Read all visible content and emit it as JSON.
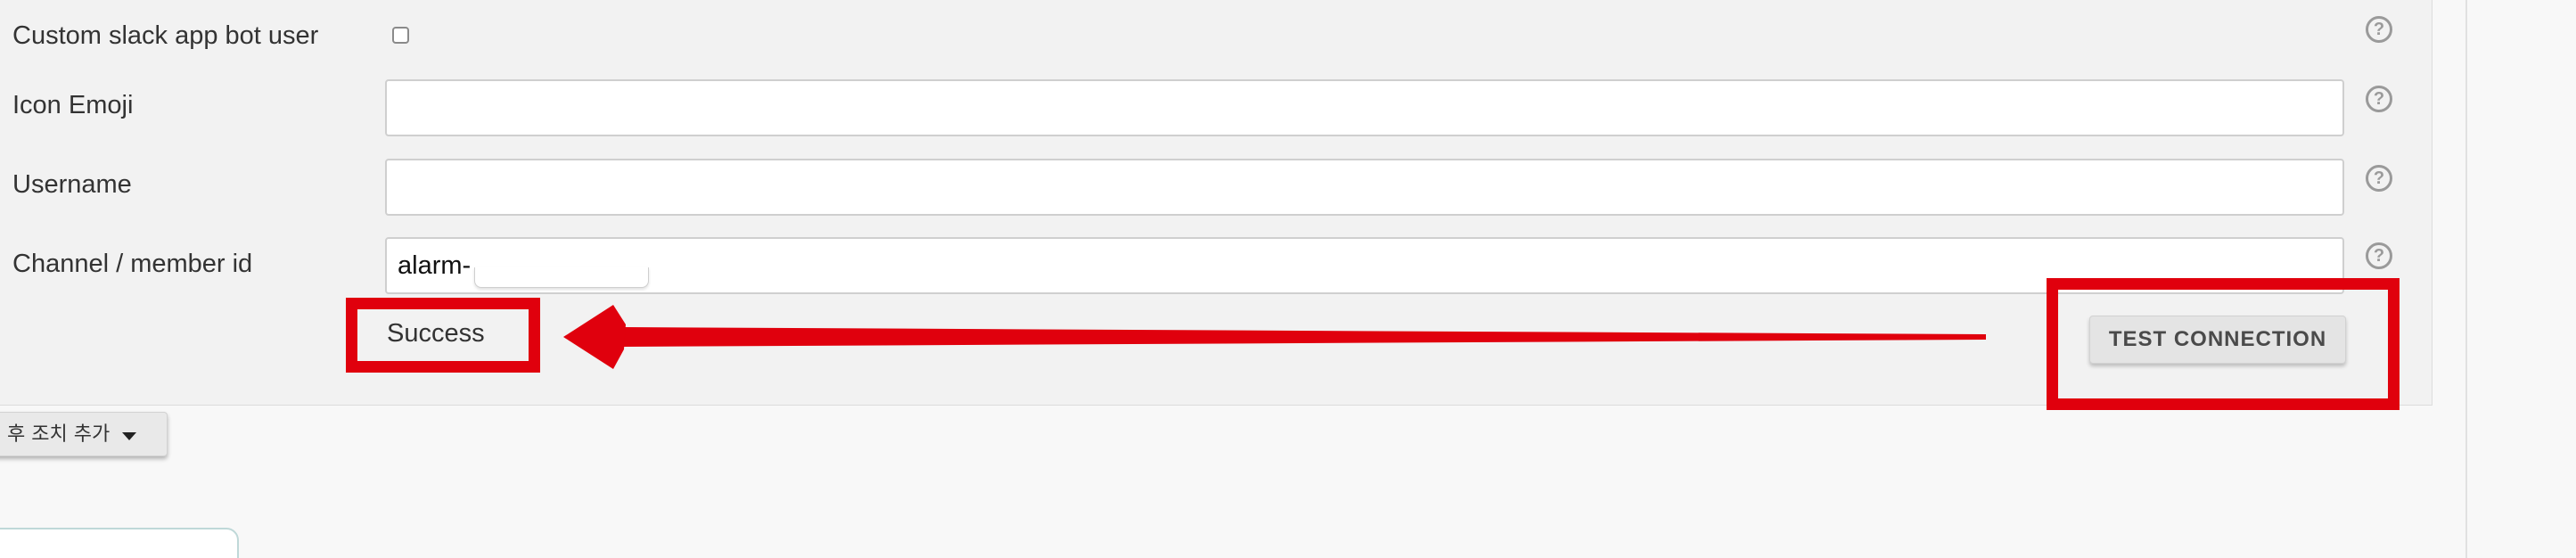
{
  "fields": {
    "custom_bot": {
      "label": "Custom slack app bot user",
      "checked": false
    },
    "icon_emoji": {
      "label": "Icon Emoji",
      "value": ""
    },
    "username": {
      "label": "Username",
      "value": ""
    },
    "channel": {
      "label": "Channel / member id",
      "value": "alarm-"
    }
  },
  "help_glyph": "?",
  "status": {
    "text": "Success"
  },
  "test_connection": {
    "label": "TEST CONNECTION"
  },
  "add_post_build": {
    "label": " 후 조치 추가"
  },
  "colors": {
    "highlight": "#e0000d",
    "panel": "#f2f2f2",
    "button": "#e4e4e4"
  },
  "icons": [
    "help-icon",
    "dropdown-caret-icon",
    "arrow-annotation"
  ]
}
